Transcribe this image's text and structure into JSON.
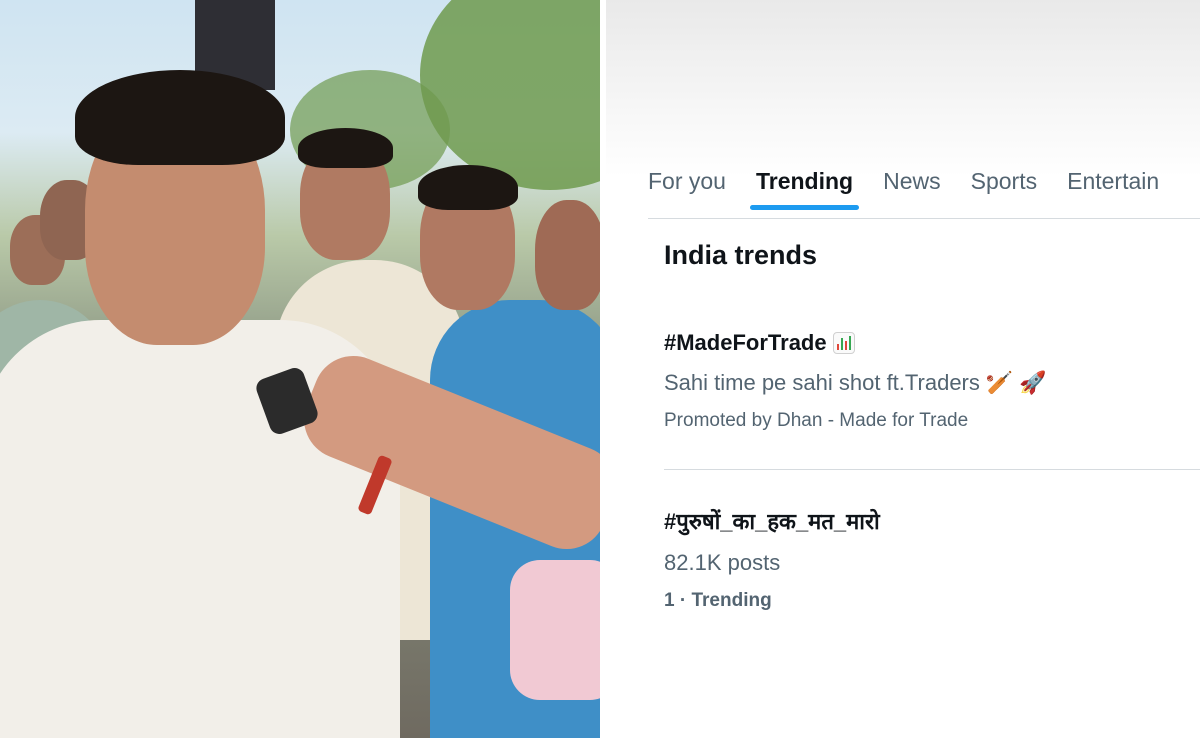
{
  "explore": {
    "tabs": [
      {
        "label": "For you",
        "active": false
      },
      {
        "label": "Trending",
        "active": true
      },
      {
        "label": "News",
        "active": false
      },
      {
        "label": "Sports",
        "active": false
      },
      {
        "label": "Entertain",
        "active": false
      }
    ],
    "section_title": "India trends",
    "trends": [
      {
        "tag": "#MadeForTrade",
        "tag_icon": "bar-chart-icon",
        "subtitle": "Sahi time pe sahi shot ft.Traders",
        "subtitle_icons": [
          "cricket-bat-icon",
          "rocket-icon"
        ],
        "meta": "Promoted by Dhan - Made for Trade"
      },
      {
        "tag": "#पुरुषों_का_हक_मत_मारो",
        "posts": "82.1K posts",
        "rank": "1",
        "meta_suffix": " · Trending"
      }
    ]
  },
  "colors": {
    "accent": "#1d9bf0",
    "text_primary": "#0f1419",
    "text_secondary": "#536471"
  }
}
